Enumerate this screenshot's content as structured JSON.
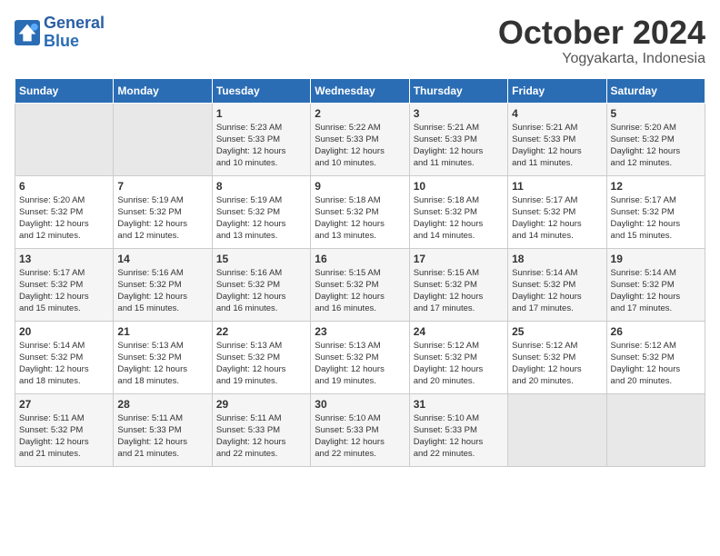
{
  "header": {
    "logo_line1": "General",
    "logo_line2": "Blue",
    "month": "October 2024",
    "location": "Yogyakarta, Indonesia"
  },
  "days_of_week": [
    "Sunday",
    "Monday",
    "Tuesday",
    "Wednesday",
    "Thursday",
    "Friday",
    "Saturday"
  ],
  "weeks": [
    [
      {
        "day": "",
        "info": ""
      },
      {
        "day": "",
        "info": ""
      },
      {
        "day": "1",
        "info": "Sunrise: 5:23 AM\nSunset: 5:33 PM\nDaylight: 12 hours\nand 10 minutes."
      },
      {
        "day": "2",
        "info": "Sunrise: 5:22 AM\nSunset: 5:33 PM\nDaylight: 12 hours\nand 10 minutes."
      },
      {
        "day": "3",
        "info": "Sunrise: 5:21 AM\nSunset: 5:33 PM\nDaylight: 12 hours\nand 11 minutes."
      },
      {
        "day": "4",
        "info": "Sunrise: 5:21 AM\nSunset: 5:33 PM\nDaylight: 12 hours\nand 11 minutes."
      },
      {
        "day": "5",
        "info": "Sunrise: 5:20 AM\nSunset: 5:32 PM\nDaylight: 12 hours\nand 12 minutes."
      }
    ],
    [
      {
        "day": "6",
        "info": "Sunrise: 5:20 AM\nSunset: 5:32 PM\nDaylight: 12 hours\nand 12 minutes."
      },
      {
        "day": "7",
        "info": "Sunrise: 5:19 AM\nSunset: 5:32 PM\nDaylight: 12 hours\nand 12 minutes."
      },
      {
        "day": "8",
        "info": "Sunrise: 5:19 AM\nSunset: 5:32 PM\nDaylight: 12 hours\nand 13 minutes."
      },
      {
        "day": "9",
        "info": "Sunrise: 5:18 AM\nSunset: 5:32 PM\nDaylight: 12 hours\nand 13 minutes."
      },
      {
        "day": "10",
        "info": "Sunrise: 5:18 AM\nSunset: 5:32 PM\nDaylight: 12 hours\nand 14 minutes."
      },
      {
        "day": "11",
        "info": "Sunrise: 5:17 AM\nSunset: 5:32 PM\nDaylight: 12 hours\nand 14 minutes."
      },
      {
        "day": "12",
        "info": "Sunrise: 5:17 AM\nSunset: 5:32 PM\nDaylight: 12 hours\nand 15 minutes."
      }
    ],
    [
      {
        "day": "13",
        "info": "Sunrise: 5:17 AM\nSunset: 5:32 PM\nDaylight: 12 hours\nand 15 minutes."
      },
      {
        "day": "14",
        "info": "Sunrise: 5:16 AM\nSunset: 5:32 PM\nDaylight: 12 hours\nand 15 minutes."
      },
      {
        "day": "15",
        "info": "Sunrise: 5:16 AM\nSunset: 5:32 PM\nDaylight: 12 hours\nand 16 minutes."
      },
      {
        "day": "16",
        "info": "Sunrise: 5:15 AM\nSunset: 5:32 PM\nDaylight: 12 hours\nand 16 minutes."
      },
      {
        "day": "17",
        "info": "Sunrise: 5:15 AM\nSunset: 5:32 PM\nDaylight: 12 hours\nand 17 minutes."
      },
      {
        "day": "18",
        "info": "Sunrise: 5:14 AM\nSunset: 5:32 PM\nDaylight: 12 hours\nand 17 minutes."
      },
      {
        "day": "19",
        "info": "Sunrise: 5:14 AM\nSunset: 5:32 PM\nDaylight: 12 hours\nand 17 minutes."
      }
    ],
    [
      {
        "day": "20",
        "info": "Sunrise: 5:14 AM\nSunset: 5:32 PM\nDaylight: 12 hours\nand 18 minutes."
      },
      {
        "day": "21",
        "info": "Sunrise: 5:13 AM\nSunset: 5:32 PM\nDaylight: 12 hours\nand 18 minutes."
      },
      {
        "day": "22",
        "info": "Sunrise: 5:13 AM\nSunset: 5:32 PM\nDaylight: 12 hours\nand 19 minutes."
      },
      {
        "day": "23",
        "info": "Sunrise: 5:13 AM\nSunset: 5:32 PM\nDaylight: 12 hours\nand 19 minutes."
      },
      {
        "day": "24",
        "info": "Sunrise: 5:12 AM\nSunset: 5:32 PM\nDaylight: 12 hours\nand 20 minutes."
      },
      {
        "day": "25",
        "info": "Sunrise: 5:12 AM\nSunset: 5:32 PM\nDaylight: 12 hours\nand 20 minutes."
      },
      {
        "day": "26",
        "info": "Sunrise: 5:12 AM\nSunset: 5:32 PM\nDaylight: 12 hours\nand 20 minutes."
      }
    ],
    [
      {
        "day": "27",
        "info": "Sunrise: 5:11 AM\nSunset: 5:32 PM\nDaylight: 12 hours\nand 21 minutes."
      },
      {
        "day": "28",
        "info": "Sunrise: 5:11 AM\nSunset: 5:33 PM\nDaylight: 12 hours\nand 21 minutes."
      },
      {
        "day": "29",
        "info": "Sunrise: 5:11 AM\nSunset: 5:33 PM\nDaylight: 12 hours\nand 22 minutes."
      },
      {
        "day": "30",
        "info": "Sunrise: 5:10 AM\nSunset: 5:33 PM\nDaylight: 12 hours\nand 22 minutes."
      },
      {
        "day": "31",
        "info": "Sunrise: 5:10 AM\nSunset: 5:33 PM\nDaylight: 12 hours\nand 22 minutes."
      },
      {
        "day": "",
        "info": ""
      },
      {
        "day": "",
        "info": ""
      }
    ]
  ]
}
